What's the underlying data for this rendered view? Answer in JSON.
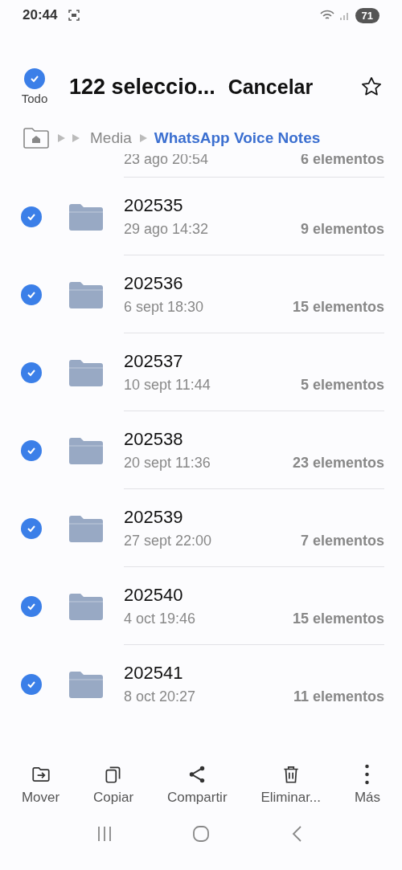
{
  "status_bar": {
    "time": "20:44",
    "battery": "71"
  },
  "header": {
    "select_all": {
      "label": "Todo",
      "checked": true
    },
    "title": "122 seleccio...",
    "cancel": "Cancelar",
    "favorite": false
  },
  "breadcrumb": [
    {
      "label": "Media",
      "current": false
    },
    {
      "label": "WhatsApp Voice Notes",
      "current": true
    }
  ],
  "partial_row": {
    "date": "23 ago 20:54",
    "count": "6 elementos"
  },
  "folders": [
    {
      "name": "202535",
      "date": "29 ago 14:32",
      "count": "9 elementos",
      "checked": true
    },
    {
      "name": "202536",
      "date": "6 sept 18:30",
      "count": "15 elementos",
      "checked": true
    },
    {
      "name": "202537",
      "date": "10 sept 11:44",
      "count": "5 elementos",
      "checked": true
    },
    {
      "name": "202538",
      "date": "20 sept 11:36",
      "count": "23 elementos",
      "checked": true
    },
    {
      "name": "202539",
      "date": "27 sept 22:00",
      "count": "7 elementos",
      "checked": true
    },
    {
      "name": "202540",
      "date": "4 oct 19:46",
      "count": "15 elementos",
      "checked": true
    },
    {
      "name": "202541",
      "date": "8 oct 20:27",
      "count": "11 elementos",
      "checked": true
    }
  ],
  "actions": [
    {
      "kind": "move",
      "label": "Mover"
    },
    {
      "kind": "copy",
      "label": "Copiar"
    },
    {
      "kind": "share",
      "label": "Compartir"
    },
    {
      "kind": "delete",
      "label": "Eliminar..."
    },
    {
      "kind": "more",
      "label": "Más"
    }
  ]
}
